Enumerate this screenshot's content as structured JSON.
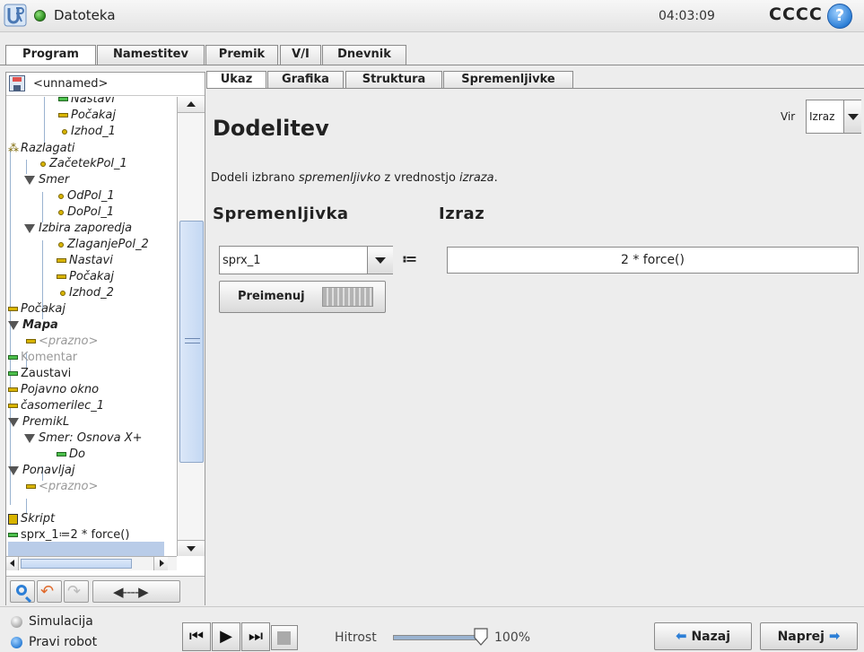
{
  "header": {
    "title": "Datoteka",
    "clock": "04:03:09",
    "robot_name": "CCCC",
    "help": "?"
  },
  "top_tabs": [
    "Program",
    "Namestitev",
    "Premik",
    "V/I",
    "Dnevnik"
  ],
  "program": {
    "name": "<unnamed>"
  },
  "tree": [
    {
      "label": "Nastavi"
    },
    {
      "label": "Počakaj"
    },
    {
      "label": "Izhod_1"
    },
    {
      "label": "Razlagati"
    },
    {
      "label": "ZačetekPol_1"
    },
    {
      "label": "Smer"
    },
    {
      "label": "OdPol_1"
    },
    {
      "label": "DoPol_1"
    },
    {
      "label": "Izbira zaporedja"
    },
    {
      "label": "ZlaganjePol_2"
    },
    {
      "label": "Nastavi"
    },
    {
      "label": "Počakaj"
    },
    {
      "label": "Izhod_2"
    },
    {
      "label": "Počakaj"
    },
    {
      "label": "Mapa"
    },
    {
      "label": "<prazno>"
    },
    {
      "label": "Komentar"
    },
    {
      "label": "Zaustavi"
    },
    {
      "label": "Pojavno okno"
    },
    {
      "label": "časomerilec_1"
    },
    {
      "label": "PremikL"
    },
    {
      "label": "Smer: Osnova X+"
    },
    {
      "label": "Do"
    },
    {
      "label": "Ponavljaj"
    },
    {
      "label": "<prazno>"
    },
    {
      "label": "Skript"
    },
    {
      "label": "sprx_1≔2 * force()"
    }
  ],
  "sub_tabs": [
    "Ukaz",
    "Grafika",
    "Struktura",
    "Spremenljivke"
  ],
  "command": {
    "heading": "Dodelitev",
    "source_label": "Vir",
    "source_value": "Izraz",
    "description_pre": "Dodeli izbrano ",
    "description_var": "spremenljivko",
    "description_mid": " z vrednostjo ",
    "description_expr": "izraza",
    "description_end": ".",
    "var_heading": "Spremenljivka",
    "expr_heading": "Izraz",
    "variable": "sprx_1",
    "assign_op": "≔",
    "expression": "2 * force()",
    "rename_label": "Preimenuj"
  },
  "footer": {
    "simulation": "Simulacija",
    "real_robot": "Pravi robot",
    "speed_label": "Hitrost",
    "speed_value": "100%",
    "speed_fraction": 1.0,
    "back": "Nazaj",
    "next": "Naprej"
  },
  "colors": {
    "accent": "#2d7fd6",
    "selection": "#b9cce8",
    "run_green": "#4cc04c",
    "wait_yellow": "#d8b400"
  }
}
